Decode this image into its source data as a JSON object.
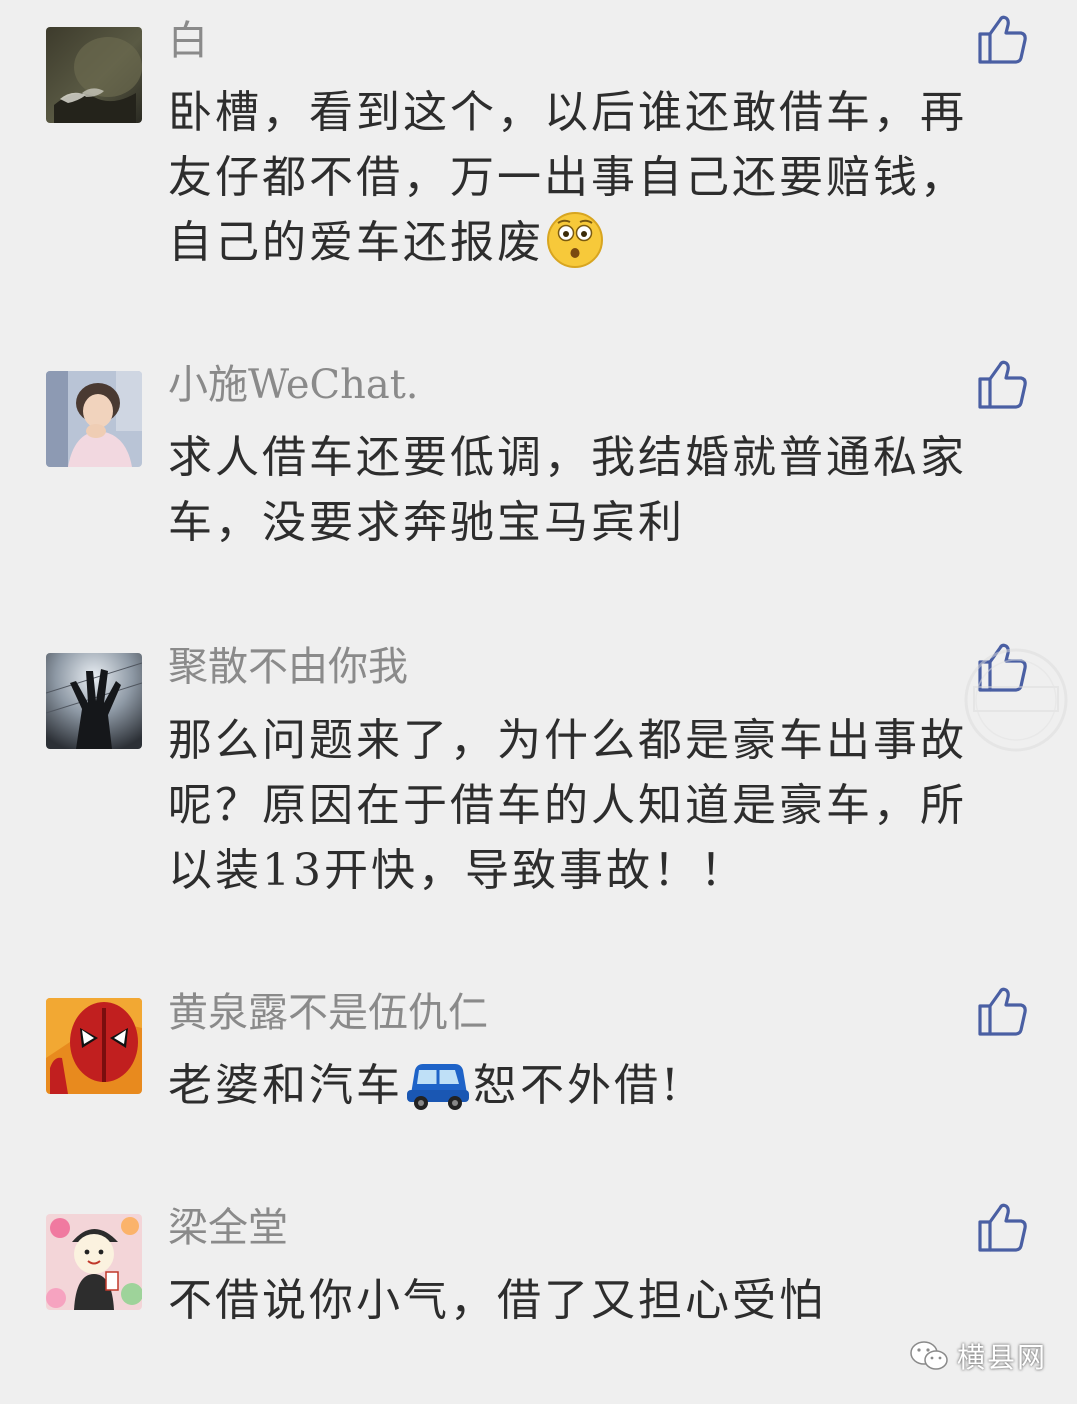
{
  "comments": [
    {
      "nickname": "白",
      "text": "卧槽，看到这个，以后谁还敢借车，再友仔都不借，万一出事自己还要赔钱，自己的爱车还报废",
      "emoji": "flushed-face-emoji"
    },
    {
      "nickname": "小施WeChat.",
      "text": "求人借车还要低调，我结婚就普通私家车，没要求奔驰宝马宾利"
    },
    {
      "nickname": "聚散不由你我",
      "text": "那么问题来了，为什么都是豪车出事故呢？原因在于借车的人知道是豪车，所以装13开快，导致事故！！"
    },
    {
      "nickname": "黄泉露不是伍仇仁",
      "text_before": "老婆和汽车",
      "text_after": "恕不外借!",
      "emoji": "blue-car-emoji"
    },
    {
      "nickname": "梁全堂",
      "text": "不借说你小气，借了又担心受怕"
    }
  ],
  "footer": {
    "brand": "横县网"
  },
  "colors": {
    "background": "#efefef",
    "nickname": "#8a8a8a",
    "text": "#2d2d2d",
    "like_icon": "#4a5fa3"
  },
  "icons": {
    "like": "thumbs-up-icon",
    "brand": "wechat-icon"
  }
}
